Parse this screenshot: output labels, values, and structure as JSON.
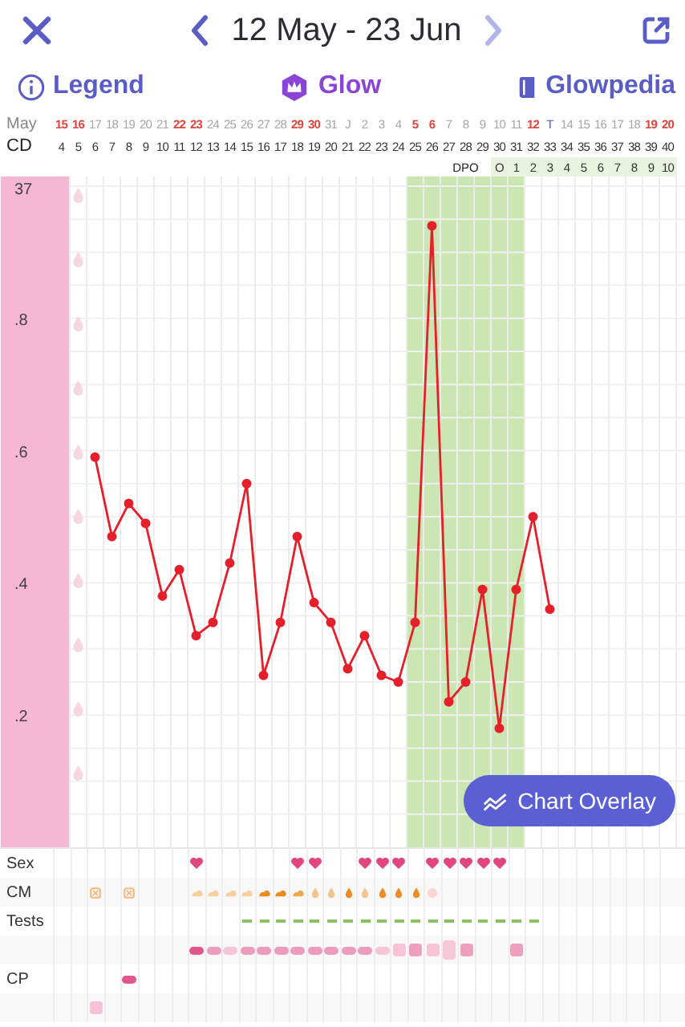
{
  "toolbar": {
    "date_range": "12 May - 23 Jun",
    "prev": {
      "disabled": false
    },
    "next": {
      "disabled": true
    }
  },
  "links": [
    {
      "label": "Legend",
      "kind": "info"
    },
    {
      "label": "Glow",
      "kind": "brand"
    },
    {
      "label": "Glowpedia",
      "kind": "book"
    }
  ],
  "header": {
    "date_label": "May",
    "cd_label": "CD",
    "dpo_label": "DPO"
  },
  "columns": [
    {
      "date": "15",
      "weekend": true,
      "today": false,
      "spotting": false
    },
    {
      "date": "16",
      "weekend": true,
      "today": false,
      "spotting": true
    },
    {
      "date": "17",
      "weekend": false,
      "today": false,
      "spotting": false
    },
    {
      "date": "18",
      "weekend": false,
      "today": false,
      "spotting": false
    },
    {
      "date": "19",
      "weekend": false,
      "today": false,
      "spotting": false
    },
    {
      "date": "20",
      "weekend": false,
      "today": false,
      "spotting": false
    },
    {
      "date": "21",
      "weekend": false,
      "today": false,
      "spotting": false
    },
    {
      "date": "22",
      "weekend": true,
      "today": false,
      "spotting": false
    },
    {
      "date": "23",
      "weekend": true,
      "today": false,
      "spotting": false
    },
    {
      "date": "24",
      "weekend": false,
      "today": false,
      "spotting": false
    },
    {
      "date": "25",
      "weekend": false,
      "today": false,
      "spotting": false
    },
    {
      "date": "26",
      "weekend": false,
      "today": false,
      "spotting": false
    },
    {
      "date": "27",
      "weekend": false,
      "today": false,
      "spotting": false
    },
    {
      "date": "28",
      "weekend": false,
      "today": false,
      "spotting": false
    },
    {
      "date": "29",
      "weekend": true,
      "today": false,
      "spotting": false
    },
    {
      "date": "30",
      "weekend": true,
      "today": false,
      "spotting": false
    },
    {
      "date": "31",
      "weekend": false,
      "today": false,
      "spotting": false
    },
    {
      "date": "J",
      "weekend": false,
      "today": false,
      "spotting": false
    },
    {
      "date": "2",
      "weekend": false,
      "today": false,
      "spotting": false
    },
    {
      "date": "3",
      "weekend": false,
      "today": false,
      "spotting": false
    },
    {
      "date": "4",
      "weekend": false,
      "today": false,
      "spotting": false
    },
    {
      "date": "5",
      "weekend": true,
      "today": false,
      "spotting": false
    },
    {
      "date": "6",
      "weekend": true,
      "today": false,
      "spotting": false
    },
    {
      "date": "7",
      "weekend": false,
      "today": false,
      "spotting": false
    },
    {
      "date": "8",
      "weekend": false,
      "today": false,
      "spotting": false
    },
    {
      "date": "9",
      "weekend": false,
      "today": false,
      "spotting": false
    },
    {
      "date": "10",
      "weekend": false,
      "today": false,
      "dpo": "O",
      "spotting": false
    },
    {
      "date": "11",
      "weekend": false,
      "today": false,
      "dpo": "1",
      "spotting": false
    },
    {
      "date": "12",
      "weekend": true,
      "today": false,
      "dpo": "2",
      "spotting": false
    },
    {
      "date": "T",
      "weekend": false,
      "today": true,
      "dpo": "3",
      "spotting": false
    },
    {
      "date": "14",
      "weekend": false,
      "today": false,
      "dpo": "4",
      "spotting": false
    },
    {
      "date": "15",
      "weekend": false,
      "today": false,
      "dpo": "5",
      "spotting": false
    },
    {
      "date": "16",
      "weekend": false,
      "today": false,
      "dpo": "6",
      "spotting": false
    },
    {
      "date": "17",
      "weekend": false,
      "today": false,
      "dpo": "7",
      "spotting": false
    },
    {
      "date": "18",
      "weekend": false,
      "today": false,
      "dpo": "8",
      "spotting": false
    },
    {
      "date": "19",
      "weekend": true,
      "today": false,
      "dpo": "9",
      "spotting": false
    },
    {
      "date": "20",
      "weekend": true,
      "today": false,
      "dpo": "10",
      "spotting": false
    }
  ],
  "chart": {
    "chart_data": {
      "type": "line",
      "x": [
        6,
        7,
        8,
        9,
        10,
        11,
        12,
        13,
        14,
        15,
        16,
        17,
        18,
        19,
        20,
        21,
        22,
        23,
        24,
        25,
        26,
        27,
        28,
        29,
        30,
        31,
        32,
        33
      ],
      "xticks": [
        4,
        5,
        6,
        7,
        8,
        9,
        10,
        11,
        12,
        13,
        14,
        15,
        16,
        17,
        18,
        19,
        20,
        21,
        22,
        23,
        24,
        25,
        26,
        27,
        28,
        29,
        30,
        31,
        32,
        33,
        34,
        35,
        36,
        37,
        38,
        39,
        40
      ],
      "xlim": [
        4,
        40
      ],
      "grid": true,
      "bands": [
        {
          "axis": "x",
          "from": 0.4,
          "to": 4.5,
          "color": "#f5b7d2"
        },
        {
          "axis": "x",
          "from": 24.5,
          "to": 31.5,
          "color": "#cbe6b3"
        }
      ],
      "ylim": [
        0.0,
        1.0
      ],
      "yticks": [
        {
          "value": 0.2,
          "label": ".2"
        },
        {
          "value": 0.4,
          "label": ".4"
        },
        {
          "value": 0.6,
          "label": ".6"
        },
        {
          "value": 0.8,
          "label": ".8"
        }
      ],
      "series": [
        {
          "color": "#e5202a",
          "marker": "circle",
          "values": [
            0.59,
            0.47,
            0.52,
            0.49,
            0.38,
            0.42,
            0.32,
            0.34,
            0.43,
            0.55,
            0.26,
            0.34,
            0.47,
            0.37,
            0.34,
            0.27,
            0.32,
            0.26,
            0.25,
            0.34,
            0.94,
            0.22,
            0.25,
            0.39,
            0.18,
            0.39,
            0.5,
            0.36
          ]
        }
      ]
    },
    "top_label": "37",
    "overlay_button": "Chart Overlay"
  },
  "tracks": [
    {
      "label": "Sex",
      "cells": [
        {
          "kind": "none"
        },
        {
          "kind": "none"
        },
        {
          "kind": "none"
        },
        {
          "kind": "none"
        },
        {
          "kind": "none"
        },
        {
          "kind": "none"
        },
        {
          "kind": "none"
        },
        {
          "kind": "none"
        },
        {
          "kind": "heart"
        },
        {
          "kind": "none"
        },
        {
          "kind": "none"
        },
        {
          "kind": "none"
        },
        {
          "kind": "none"
        },
        {
          "kind": "none"
        },
        {
          "kind": "heart"
        },
        {
          "kind": "heart"
        },
        {
          "kind": "none"
        },
        {
          "kind": "none"
        },
        {
          "kind": "heart"
        },
        {
          "kind": "heart"
        },
        {
          "kind": "heart"
        },
        {
          "kind": "none"
        },
        {
          "kind": "heart"
        },
        {
          "kind": "heart"
        },
        {
          "kind": "heart"
        },
        {
          "kind": "heart"
        },
        {
          "kind": "heart"
        },
        {
          "kind": "none"
        },
        {
          "kind": "none"
        },
        {
          "kind": "none"
        },
        {
          "kind": "none"
        },
        {
          "kind": "none"
        },
        {
          "kind": "none"
        },
        {
          "kind": "none"
        },
        {
          "kind": "none"
        },
        {
          "kind": "none"
        },
        {
          "kind": "none"
        }
      ]
    },
    {
      "label": "CM",
      "cells": [
        {
          "kind": "none"
        },
        {
          "kind": "none"
        },
        {
          "kind": "cross"
        },
        {
          "kind": "none"
        },
        {
          "kind": "cross"
        },
        {
          "kind": "none"
        },
        {
          "kind": "none"
        },
        {
          "kind": "none"
        },
        {
          "kind": "blob-light"
        },
        {
          "kind": "blob-light"
        },
        {
          "kind": "blob-light"
        },
        {
          "kind": "blob-light"
        },
        {
          "kind": "blob-dark"
        },
        {
          "kind": "blob-dark"
        },
        {
          "kind": "blob-mid"
        },
        {
          "kind": "drop-light"
        },
        {
          "kind": "drop-light"
        },
        {
          "kind": "drop-dark"
        },
        {
          "kind": "drop-light"
        },
        {
          "kind": "drop-dark"
        },
        {
          "kind": "drop-dark"
        },
        {
          "kind": "drop-dark"
        },
        {
          "kind": "circle-faint"
        },
        {
          "kind": "none"
        },
        {
          "kind": "none"
        },
        {
          "kind": "none"
        },
        {
          "kind": "none"
        },
        {
          "kind": "none"
        },
        {
          "kind": "none"
        },
        {
          "kind": "none"
        },
        {
          "kind": "none"
        },
        {
          "kind": "none"
        },
        {
          "kind": "none"
        },
        {
          "kind": "none"
        },
        {
          "kind": "none"
        },
        {
          "kind": "none"
        },
        {
          "kind": "none"
        }
      ]
    },
    {
      "label": "Tests",
      "cells": [
        {
          "kind": "none"
        },
        {
          "kind": "none"
        },
        {
          "kind": "none"
        },
        {
          "kind": "none"
        },
        {
          "kind": "none"
        },
        {
          "kind": "none"
        },
        {
          "kind": "none"
        },
        {
          "kind": "none"
        },
        {
          "kind": "none"
        },
        {
          "kind": "none"
        },
        {
          "kind": "none"
        },
        {
          "kind": "dash"
        },
        {
          "kind": "dash"
        },
        {
          "kind": "dash"
        },
        {
          "kind": "dash"
        },
        {
          "kind": "dash"
        },
        {
          "kind": "dash"
        },
        {
          "kind": "dash"
        },
        {
          "kind": "dash"
        },
        {
          "kind": "dash"
        },
        {
          "kind": "dash"
        },
        {
          "kind": "dash"
        },
        {
          "kind": "dash"
        },
        {
          "kind": "dash"
        },
        {
          "kind": "dash"
        },
        {
          "kind": "dash"
        },
        {
          "kind": "dash"
        },
        {
          "kind": "dash"
        },
        {
          "kind": "dash"
        },
        {
          "kind": "none"
        },
        {
          "kind": "none"
        },
        {
          "kind": "none"
        },
        {
          "kind": "none"
        },
        {
          "kind": "none"
        },
        {
          "kind": "none"
        },
        {
          "kind": "none"
        },
        {
          "kind": "none"
        }
      ]
    },
    {
      "cells": [
        {
          "kind": "none"
        },
        {
          "kind": "none"
        },
        {
          "kind": "none"
        },
        {
          "kind": "none"
        },
        {
          "kind": "none"
        },
        {
          "kind": "none"
        },
        {
          "kind": "none"
        },
        {
          "kind": "none"
        },
        {
          "kind": "pill-dark"
        },
        {
          "kind": "pill-mid"
        },
        {
          "kind": "pill-light"
        },
        {
          "kind": "pill-mid"
        },
        {
          "kind": "pill-mid"
        },
        {
          "kind": "pill-mid"
        },
        {
          "kind": "pill-mid"
        },
        {
          "kind": "pill-mid"
        },
        {
          "kind": "pill-mid"
        },
        {
          "kind": "pill-mid"
        },
        {
          "kind": "pill-mid"
        },
        {
          "kind": "pill-light"
        },
        {
          "kind": "square-light"
        },
        {
          "kind": "square-mid"
        },
        {
          "kind": "square-light"
        },
        {
          "kind": "square-tall"
        },
        {
          "kind": "square-mid"
        },
        {
          "kind": "none"
        },
        {
          "kind": "none"
        },
        {
          "kind": "square-mid"
        },
        {
          "kind": "none"
        },
        {
          "kind": "none"
        },
        {
          "kind": "none"
        },
        {
          "kind": "none"
        },
        {
          "kind": "none"
        },
        {
          "kind": "none"
        },
        {
          "kind": "none"
        },
        {
          "kind": "none"
        },
        {
          "kind": "none"
        }
      ]
    },
    {
      "label": "CP",
      "cells": [
        {
          "kind": "none"
        },
        {
          "kind": "none"
        },
        {
          "kind": "none"
        },
        {
          "kind": "none"
        },
        {
          "kind": "pill-dark"
        },
        {
          "kind": "none"
        },
        {
          "kind": "none"
        },
        {
          "kind": "none"
        },
        {
          "kind": "none"
        },
        {
          "kind": "none"
        },
        {
          "kind": "none"
        },
        {
          "kind": "none"
        },
        {
          "kind": "none"
        },
        {
          "kind": "none"
        },
        {
          "kind": "none"
        },
        {
          "kind": "none"
        },
        {
          "kind": "none"
        },
        {
          "kind": "none"
        },
        {
          "kind": "none"
        },
        {
          "kind": "none"
        },
        {
          "kind": "none"
        },
        {
          "kind": "none"
        },
        {
          "kind": "none"
        },
        {
          "kind": "none"
        },
        {
          "kind": "none"
        },
        {
          "kind": "none"
        },
        {
          "kind": "none"
        },
        {
          "kind": "none"
        },
        {
          "kind": "none"
        },
        {
          "kind": "none"
        },
        {
          "kind": "none"
        },
        {
          "kind": "none"
        },
        {
          "kind": "none"
        },
        {
          "kind": "none"
        },
        {
          "kind": "none"
        },
        {
          "kind": "none"
        },
        {
          "kind": "none"
        }
      ]
    },
    {
      "cells": [
        {
          "kind": "none"
        },
        {
          "kind": "none"
        },
        {
          "kind": "square-light"
        },
        {
          "kind": "none"
        },
        {
          "kind": "none"
        },
        {
          "kind": "none"
        },
        {
          "kind": "none"
        },
        {
          "kind": "none"
        },
        {
          "kind": "none"
        },
        {
          "kind": "none"
        },
        {
          "kind": "none"
        },
        {
          "kind": "none"
        },
        {
          "kind": "none"
        },
        {
          "kind": "none"
        },
        {
          "kind": "none"
        },
        {
          "kind": "none"
        },
        {
          "kind": "none"
        },
        {
          "kind": "none"
        },
        {
          "kind": "none"
        },
        {
          "kind": "none"
        },
        {
          "kind": "none"
        },
        {
          "kind": "none"
        },
        {
          "kind": "none"
        },
        {
          "kind": "none"
        },
        {
          "kind": "none"
        },
        {
          "kind": "none"
        },
        {
          "kind": "none"
        },
        {
          "kind": "none"
        },
        {
          "kind": "none"
        },
        {
          "kind": "none"
        },
        {
          "kind": "none"
        },
        {
          "kind": "none"
        },
        {
          "kind": "none"
        },
        {
          "kind": "none"
        },
        {
          "kind": "none"
        },
        {
          "kind": "none"
        },
        {
          "kind": "none"
        }
      ]
    }
  ]
}
